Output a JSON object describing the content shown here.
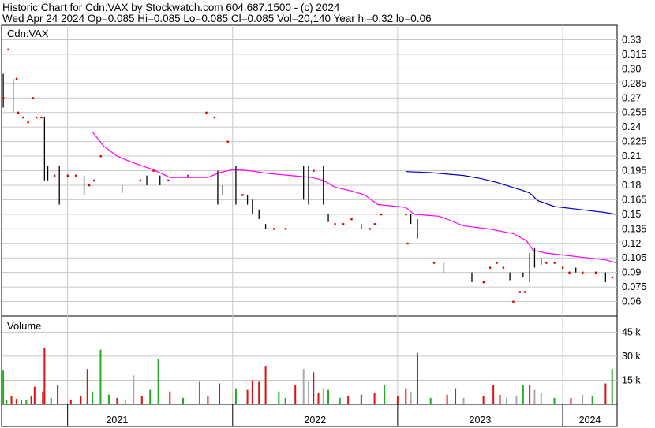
{
  "header": {
    "line1": "Historic Chart for Cdn:VAX by Stockwatch.com 604.687.1500 - (c) 2024",
    "line2": "Wed Apr 24 2024   Op=0.085  Hi=0.085  Lo=0.085  Cl=0.085  Vol=20,140  Year hi=0.32  lo=0.06"
  },
  "chart_data": [
    {
      "type": "line",
      "panel": "price",
      "title": "Cdn:VAX",
      "ylim": [
        0.045,
        0.345
      ],
      "y_ticks": [
        "0.33",
        "0.315",
        "0.30",
        "0.285",
        "0.27",
        "0.255",
        "0.24",
        "0.225",
        "0.21",
        "0.195",
        "0.18",
        "0.165",
        "0.15",
        "0.135",
        "0.12",
        "0.105",
        "0.09",
        "0.075",
        "0.06"
      ],
      "x_labels": [
        "2021",
        "2022",
        "2023",
        "2024"
      ],
      "x_range": [
        2020.6,
        2024.33
      ],
      "year_boundaries": [
        2021.0,
        2022.0,
        2023.0,
        2024.0
      ],
      "grid": true,
      "colors": {
        "grid": "#c8c8c8",
        "ma_short": "#ff00ff",
        "ma_long": "#0000cc",
        "price_bar": "#000000",
        "close_dot": "#dd0000"
      },
      "price_bars": [
        {
          "x": 2020.61,
          "hi": 0.295,
          "lo": 0.26
        },
        {
          "x": 2020.67,
          "hi": 0.29,
          "lo": 0.255
        },
        {
          "x": 2020.86,
          "hi": 0.25,
          "lo": 0.185
        },
        {
          "x": 2020.88,
          "hi": 0.2,
          "lo": 0.185
        },
        {
          "x": 2020.95,
          "hi": 0.2,
          "lo": 0.16
        },
        {
          "x": 2021.1,
          "hi": 0.19,
          "lo": 0.17
        },
        {
          "x": 2021.33,
          "hi": 0.18,
          "lo": 0.172
        },
        {
          "x": 2021.48,
          "hi": 0.19,
          "lo": 0.18
        },
        {
          "x": 2021.56,
          "hi": 0.19,
          "lo": 0.18
        },
        {
          "x": 2021.91,
          "hi": 0.195,
          "lo": 0.16
        },
        {
          "x": 2021.94,
          "hi": 0.18,
          "lo": 0.17
        },
        {
          "x": 2022.02,
          "hi": 0.2,
          "lo": 0.16
        },
        {
          "x": 2022.09,
          "hi": 0.17,
          "lo": 0.16
        },
        {
          "x": 2022.12,
          "hi": 0.165,
          "lo": 0.15
        },
        {
          "x": 2022.16,
          "hi": 0.155,
          "lo": 0.145
        },
        {
          "x": 2022.2,
          "hi": 0.14,
          "lo": 0.135
        },
        {
          "x": 2022.43,
          "hi": 0.2,
          "lo": 0.165
        },
        {
          "x": 2022.46,
          "hi": 0.2,
          "lo": 0.16
        },
        {
          "x": 2022.55,
          "hi": 0.2,
          "lo": 0.16
        },
        {
          "x": 2022.58,
          "hi": 0.15,
          "lo": 0.142
        },
        {
          "x": 2022.78,
          "hi": 0.14,
          "lo": 0.135
        },
        {
          "x": 2023.08,
          "hi": 0.15,
          "lo": 0.14
        },
        {
          "x": 2023.12,
          "hi": 0.145,
          "lo": 0.125
        },
        {
          "x": 2023.28,
          "hi": 0.1,
          "lo": 0.09
        },
        {
          "x": 2023.45,
          "hi": 0.09,
          "lo": 0.08
        },
        {
          "x": 2023.68,
          "hi": 0.09,
          "lo": 0.082
        },
        {
          "x": 2023.76,
          "hi": 0.09,
          "lo": 0.085
        },
        {
          "x": 2023.8,
          "hi": 0.11,
          "lo": 0.08
        },
        {
          "x": 2023.83,
          "hi": 0.115,
          "lo": 0.095
        },
        {
          "x": 2023.87,
          "hi": 0.105,
          "lo": 0.098
        },
        {
          "x": 2024.08,
          "hi": 0.095,
          "lo": 0.09
        },
        {
          "x": 2024.26,
          "hi": 0.09,
          "lo": 0.08
        }
      ],
      "close_points": [
        {
          "x": 2020.61,
          "y": 0.27
        },
        {
          "x": 2020.64,
          "y": 0.32
        },
        {
          "x": 2020.69,
          "y": 0.29
        },
        {
          "x": 2020.7,
          "y": 0.255
        },
        {
          "x": 2020.73,
          "y": 0.25
        },
        {
          "x": 2020.76,
          "y": 0.245
        },
        {
          "x": 2020.79,
          "y": 0.27
        },
        {
          "x": 2020.81,
          "y": 0.25
        },
        {
          "x": 2020.84,
          "y": 0.25
        },
        {
          "x": 2020.92,
          "y": 0.19
        },
        {
          "x": 2021.0,
          "y": 0.19
        },
        {
          "x": 2021.05,
          "y": 0.19
        },
        {
          "x": 2021.13,
          "y": 0.18
        },
        {
          "x": 2021.16,
          "y": 0.185
        },
        {
          "x": 2021.2,
          "y": 0.21
        },
        {
          "x": 2021.44,
          "y": 0.185
        },
        {
          "x": 2021.52,
          "y": 0.195
        },
        {
          "x": 2021.61,
          "y": 0.185
        },
        {
          "x": 2021.73,
          "y": 0.19
        },
        {
          "x": 2021.84,
          "y": 0.255
        },
        {
          "x": 2021.89,
          "y": 0.25
        },
        {
          "x": 2021.97,
          "y": 0.225
        },
        {
          "x": 2022.06,
          "y": 0.17
        },
        {
          "x": 2022.25,
          "y": 0.135
        },
        {
          "x": 2022.32,
          "y": 0.135
        },
        {
          "x": 2022.49,
          "y": 0.195
        },
        {
          "x": 2022.62,
          "y": 0.14
        },
        {
          "x": 2022.67,
          "y": 0.14
        },
        {
          "x": 2022.72,
          "y": 0.145
        },
        {
          "x": 2022.83,
          "y": 0.135
        },
        {
          "x": 2022.86,
          "y": 0.14
        },
        {
          "x": 2022.9,
          "y": 0.15
        },
        {
          "x": 2023.05,
          "y": 0.15
        },
        {
          "x": 2023.06,
          "y": 0.12
        },
        {
          "x": 2023.22,
          "y": 0.1
        },
        {
          "x": 2023.52,
          "y": 0.08
        },
        {
          "x": 2023.56,
          "y": 0.095
        },
        {
          "x": 2023.6,
          "y": 0.1
        },
        {
          "x": 2023.64,
          "y": 0.095
        },
        {
          "x": 2023.7,
          "y": 0.06
        },
        {
          "x": 2023.74,
          "y": 0.07
        },
        {
          "x": 2023.77,
          "y": 0.07
        },
        {
          "x": 2023.9,
          "y": 0.1
        },
        {
          "x": 2023.95,
          "y": 0.1
        },
        {
          "x": 2024.0,
          "y": 0.095
        },
        {
          "x": 2024.04,
          "y": 0.09
        },
        {
          "x": 2024.12,
          "y": 0.09
        },
        {
          "x": 2024.2,
          "y": 0.09
        },
        {
          "x": 2024.3,
          "y": 0.085
        }
      ],
      "ma_short": [
        {
          "x": 2021.15,
          "y": 0.235
        },
        {
          "x": 2021.22,
          "y": 0.22
        },
        {
          "x": 2021.3,
          "y": 0.21
        },
        {
          "x": 2021.4,
          "y": 0.203
        },
        {
          "x": 2021.52,
          "y": 0.196
        },
        {
          "x": 2021.62,
          "y": 0.188
        },
        {
          "x": 2021.85,
          "y": 0.188
        },
        {
          "x": 2021.92,
          "y": 0.193
        },
        {
          "x": 2022.0,
          "y": 0.196
        },
        {
          "x": 2022.1,
          "y": 0.195
        },
        {
          "x": 2022.22,
          "y": 0.192
        },
        {
          "x": 2022.35,
          "y": 0.19
        },
        {
          "x": 2022.48,
          "y": 0.188
        },
        {
          "x": 2022.55,
          "y": 0.185
        },
        {
          "x": 2022.62,
          "y": 0.178
        },
        {
          "x": 2022.72,
          "y": 0.174
        },
        {
          "x": 2022.8,
          "y": 0.17
        },
        {
          "x": 2022.88,
          "y": 0.16
        },
        {
          "x": 2023.0,
          "y": 0.158
        },
        {
          "x": 2023.05,
          "y": 0.157
        },
        {
          "x": 2023.1,
          "y": 0.15
        },
        {
          "x": 2023.25,
          "y": 0.148
        },
        {
          "x": 2023.3,
          "y": 0.145
        },
        {
          "x": 2023.4,
          "y": 0.138
        },
        {
          "x": 2023.55,
          "y": 0.135
        },
        {
          "x": 2023.7,
          "y": 0.13
        },
        {
          "x": 2023.78,
          "y": 0.123
        },
        {
          "x": 2023.82,
          "y": 0.113
        },
        {
          "x": 2023.9,
          "y": 0.11
        },
        {
          "x": 2024.0,
          "y": 0.108
        },
        {
          "x": 2024.15,
          "y": 0.105
        },
        {
          "x": 2024.26,
          "y": 0.103
        },
        {
          "x": 2024.32,
          "y": 0.1
        }
      ],
      "ma_long": [
        {
          "x": 2023.05,
          "y": 0.194
        },
        {
          "x": 2023.2,
          "y": 0.193
        },
        {
          "x": 2023.4,
          "y": 0.19
        },
        {
          "x": 2023.5,
          "y": 0.187
        },
        {
          "x": 2023.6,
          "y": 0.183
        },
        {
          "x": 2023.75,
          "y": 0.175
        },
        {
          "x": 2023.8,
          "y": 0.172
        },
        {
          "x": 2023.85,
          "y": 0.164
        },
        {
          "x": 2023.95,
          "y": 0.158
        },
        {
          "x": 2024.1,
          "y": 0.155
        },
        {
          "x": 2024.25,
          "y": 0.152
        },
        {
          "x": 2024.32,
          "y": 0.15
        }
      ]
    },
    {
      "type": "bar",
      "panel": "volume",
      "title": "Volume",
      "ylim": [
        0,
        55000
      ],
      "y_ticks": [
        {
          "label": "45 k",
          "v": 45000
        },
        {
          "label": "30 k",
          "v": 30000
        },
        {
          "label": "15 k",
          "v": 15000
        }
      ],
      "x_range": [
        2020.6,
        2024.33
      ],
      "bars": [
        {
          "x": 2020.61,
          "v": 21000,
          "c": "green"
        },
        {
          "x": 2020.63,
          "v": 3000,
          "c": "green"
        },
        {
          "x": 2020.66,
          "v": 5000,
          "c": "red"
        },
        {
          "x": 2020.69,
          "v": 3500,
          "c": "red"
        },
        {
          "x": 2020.72,
          "v": 2500,
          "c": "green"
        },
        {
          "x": 2020.75,
          "v": 3000,
          "c": "green"
        },
        {
          "x": 2020.78,
          "v": 5000,
          "c": "red"
        },
        {
          "x": 2020.8,
          "v": 11000,
          "c": "red"
        },
        {
          "x": 2020.85,
          "v": 8000,
          "c": "red"
        },
        {
          "x": 2020.86,
          "v": 35000,
          "c": "red"
        },
        {
          "x": 2020.9,
          "v": 4000,
          "c": "green"
        },
        {
          "x": 2020.94,
          "v": 12000,
          "c": "red"
        },
        {
          "x": 2021.02,
          "v": 3000,
          "c": "red"
        },
        {
          "x": 2021.08,
          "v": 5000,
          "c": "red"
        },
        {
          "x": 2021.12,
          "v": 22000,
          "c": "red"
        },
        {
          "x": 2021.15,
          "v": 8000,
          "c": "green"
        },
        {
          "x": 2021.2,
          "v": 34000,
          "c": "green"
        },
        {
          "x": 2021.25,
          "v": 6000,
          "c": "green"
        },
        {
          "x": 2021.3,
          "v": 4000,
          "c": "red"
        },
        {
          "x": 2021.35,
          "v": 3000,
          "c": "gray"
        },
        {
          "x": 2021.4,
          "v": 18000,
          "c": "gray"
        },
        {
          "x": 2021.45,
          "v": 5000,
          "c": "red"
        },
        {
          "x": 2021.5,
          "v": 9000,
          "c": "green"
        },
        {
          "x": 2021.55,
          "v": 28000,
          "c": "green"
        },
        {
          "x": 2021.62,
          "v": 8000,
          "c": "red"
        },
        {
          "x": 2021.7,
          "v": 4000,
          "c": "green"
        },
        {
          "x": 2021.8,
          "v": 14000,
          "c": "green"
        },
        {
          "x": 2021.85,
          "v": 5000,
          "c": "red"
        },
        {
          "x": 2021.92,
          "v": 13000,
          "c": "red"
        },
        {
          "x": 2022.02,
          "v": 10000,
          "c": "green"
        },
        {
          "x": 2022.09,
          "v": 9000,
          "c": "red"
        },
        {
          "x": 2022.12,
          "v": 15000,
          "c": "red"
        },
        {
          "x": 2022.16,
          "v": 14000,
          "c": "red"
        },
        {
          "x": 2022.2,
          "v": 24000,
          "c": "red"
        },
        {
          "x": 2022.28,
          "v": 8000,
          "c": "green"
        },
        {
          "x": 2022.32,
          "v": 4000,
          "c": "green"
        },
        {
          "x": 2022.38,
          "v": 12000,
          "c": "red"
        },
        {
          "x": 2022.43,
          "v": 22000,
          "c": "gray"
        },
        {
          "x": 2022.46,
          "v": 14000,
          "c": "gray"
        },
        {
          "x": 2022.49,
          "v": 20000,
          "c": "red"
        },
        {
          "x": 2022.52,
          "v": 7000,
          "c": "red"
        },
        {
          "x": 2022.55,
          "v": 10000,
          "c": "gray"
        },
        {
          "x": 2022.58,
          "v": 9000,
          "c": "green"
        },
        {
          "x": 2022.65,
          "v": 4000,
          "c": "green"
        },
        {
          "x": 2022.7,
          "v": 5000,
          "c": "red"
        },
        {
          "x": 2022.78,
          "v": 6000,
          "c": "red"
        },
        {
          "x": 2022.86,
          "v": 7000,
          "c": "red"
        },
        {
          "x": 2022.92,
          "v": 12000,
          "c": "green"
        },
        {
          "x": 2023.0,
          "v": 5000,
          "c": "red"
        },
        {
          "x": 2023.05,
          "v": 10000,
          "c": "red"
        },
        {
          "x": 2023.08,
          "v": 8000,
          "c": "gray"
        },
        {
          "x": 2023.12,
          "v": 32000,
          "c": "red"
        },
        {
          "x": 2023.2,
          "v": 4000,
          "c": "green"
        },
        {
          "x": 2023.3,
          "v": 6000,
          "c": "red"
        },
        {
          "x": 2023.35,
          "v": 10000,
          "c": "red"
        },
        {
          "x": 2023.4,
          "v": 4000,
          "c": "gray"
        },
        {
          "x": 2023.52,
          "v": 5000,
          "c": "red"
        },
        {
          "x": 2023.58,
          "v": 12000,
          "c": "red"
        },
        {
          "x": 2023.62,
          "v": 6000,
          "c": "red"
        },
        {
          "x": 2023.66,
          "v": 4000,
          "c": "gray"
        },
        {
          "x": 2023.72,
          "v": 5000,
          "c": "gray"
        },
        {
          "x": 2023.76,
          "v": 12000,
          "c": "green"
        },
        {
          "x": 2023.8,
          "v": 12000,
          "c": "red"
        },
        {
          "x": 2023.83,
          "v": 9000,
          "c": "gray"
        },
        {
          "x": 2023.87,
          "v": 7000,
          "c": "gray"
        },
        {
          "x": 2023.95,
          "v": 4000,
          "c": "green"
        },
        {
          "x": 2024.05,
          "v": 4000,
          "c": "red"
        },
        {
          "x": 2024.12,
          "v": 6000,
          "c": "gray"
        },
        {
          "x": 2024.18,
          "v": 5000,
          "c": "green"
        },
        {
          "x": 2024.26,
          "v": 13000,
          "c": "red"
        },
        {
          "x": 2024.3,
          "v": 22000,
          "c": "green"
        }
      ],
      "colors": {
        "green": "#22aa22",
        "red": "#dd1111",
        "gray": "#aaaaaa"
      }
    }
  ]
}
